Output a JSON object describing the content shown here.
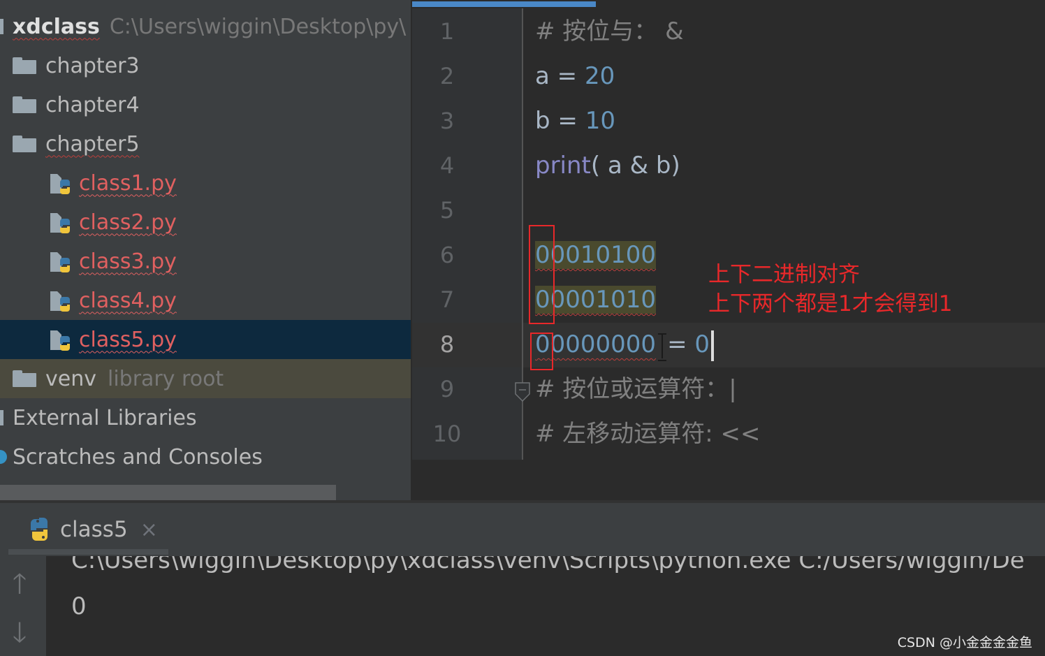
{
  "project_tree": {
    "root": {
      "label": "xdclass",
      "path": "C:\\Users\\wiggin\\Desktop\\py\\"
    },
    "items": [
      {
        "label": "chapter3",
        "type": "folder"
      },
      {
        "label": "chapter4",
        "type": "folder"
      },
      {
        "label": "chapter5",
        "type": "folder"
      },
      {
        "label": "class1.py",
        "type": "python-file"
      },
      {
        "label": "class2.py",
        "type": "python-file"
      },
      {
        "label": "class3.py",
        "type": "python-file"
      },
      {
        "label": "class4.py",
        "type": "python-file"
      },
      {
        "label": "class5.py",
        "type": "python-file",
        "selected": true
      },
      {
        "label": "venv",
        "type": "folder",
        "hint": "library root"
      }
    ],
    "external_libraries": "External Libraries",
    "scratches": "Scratches and Consoles"
  },
  "editor": {
    "line_numbers": [
      "1",
      "2",
      "3",
      "4",
      "5",
      "6",
      "7",
      "8",
      "9",
      "10"
    ],
    "current_line": 8,
    "lines": {
      "l1": {
        "comment": "# 按位与： &"
      },
      "l2": {
        "var": "a",
        "op": " = ",
        "num": "20"
      },
      "l3": {
        "var": "b",
        "op": " = ",
        "num": "10"
      },
      "l4": {
        "builtin": "print",
        "rest": "( a & b)"
      },
      "l6": {
        "num": "00010100"
      },
      "l7": {
        "num": "00001010"
      },
      "l8": {
        "num": "00000000",
        "op": "= ",
        "result": "0"
      },
      "l9": {
        "comment": "# 按位或运算符：|"
      },
      "l10": {
        "comment": "# 左移动运算符: <<"
      }
    },
    "annotation": {
      "line1": "上下二进制对齐",
      "line2": "上下两个都是1才会得到1"
    }
  },
  "run": {
    "tab_label": "class5",
    "close_icon": "×",
    "up_arrow": "🡑",
    "down_arrow": "🡓",
    "console": [
      "C:\\Users\\wiggin\\Desktop\\py\\xdclass\\venv\\Scripts\\python.exe C:/Users/wiggin/De",
      "0"
    ]
  },
  "watermark": "CSDN @小金金金金鱼",
  "colors": {
    "accent": "#4a88c7",
    "error_red": "#e06060",
    "annotation_red": "#e8282a",
    "number_blue": "#6897bb"
  }
}
